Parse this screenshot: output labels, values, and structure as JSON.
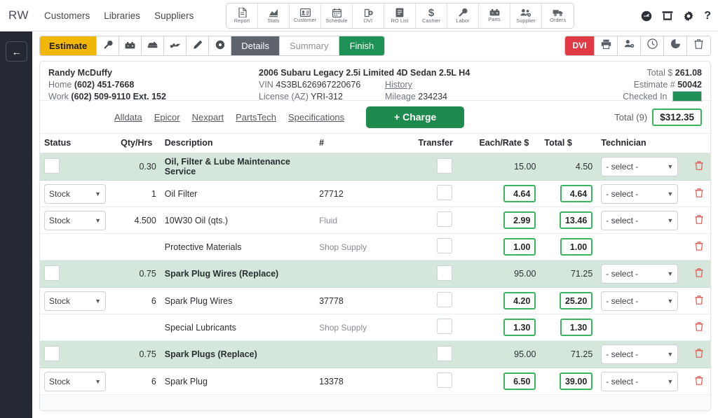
{
  "app": {
    "brand": "RW",
    "nav": [
      {
        "label": "Customers"
      },
      {
        "label": "Libraries"
      },
      {
        "label": "Suppliers"
      }
    ],
    "toolbar": [
      {
        "label": "Report",
        "icon": "report-icon"
      },
      {
        "label": "Stats",
        "icon": "stats-icon"
      },
      {
        "label": "Customer",
        "icon": "customer-card-icon"
      },
      {
        "label": "Schedule",
        "icon": "calendar-icon"
      },
      {
        "label": "DVI",
        "icon": "dvi-icon"
      },
      {
        "label": "RO List",
        "icon": "ro-list-icon"
      },
      {
        "label": "Cashier",
        "icon": "dollar-icon"
      },
      {
        "label": "Labor",
        "icon": "wrench-icon"
      },
      {
        "label": "Parts",
        "icon": "battery-icon"
      },
      {
        "label": "Supplier",
        "icon": "supplier-group-icon"
      },
      {
        "label": "Orders",
        "icon": "truck-icon"
      }
    ],
    "top_right_icons": [
      {
        "name": "dashboard-gauge-icon"
      },
      {
        "name": "shop-store-icon"
      },
      {
        "name": "settings-gear-icon"
      },
      {
        "name": "help-question-icon"
      }
    ]
  },
  "sidebar": {
    "back_label": "←"
  },
  "actionbar": {
    "estimate_label": "Estimate",
    "mode_icons": [
      {
        "name": "wrench-icon"
      },
      {
        "name": "battery-icon"
      },
      {
        "name": "car-repair-icon"
      },
      {
        "name": "oil-can-icon"
      },
      {
        "name": "pen-icon"
      },
      {
        "name": "circle-dot-icon"
      }
    ],
    "details_label": "Details",
    "summary_label": "Summary",
    "finish_label": "Finish",
    "right_buttons": [
      {
        "label": "DVI",
        "name": "dvi-button"
      },
      {
        "label": "",
        "name": "print-icon"
      },
      {
        "label": "",
        "name": "assign-user-icon"
      },
      {
        "label": "",
        "name": "clock-history-icon"
      },
      {
        "label": "",
        "name": "pie-chart-icon"
      },
      {
        "label": "",
        "name": "delete-trash-icon"
      }
    ]
  },
  "customer": {
    "name": "Randy McDuffy",
    "home_label": "Home",
    "home_phone": "(602) 451-7668",
    "work_label": "Work",
    "work_phone": "(602) 509-9110 Ext. 152"
  },
  "vehicle": {
    "title": "2006 Subaru Legacy 2.5i Limited 4D Sedan 2.5L H4",
    "vin_label": "VIN",
    "vin": "4S3BL626967220676",
    "history_link": "History",
    "license_label": "License (AZ)",
    "license": "YRI-312",
    "mileage_label": "Mileage",
    "mileage": "234234"
  },
  "summary": {
    "total_label": "Total $",
    "total_value": "261.08",
    "estimate_label": "Estimate #",
    "estimate_value": "50042",
    "status_label": "Checked In",
    "status_color": "#1e8f57"
  },
  "parts_links": [
    {
      "label": "Alldata"
    },
    {
      "label": "Epicor"
    },
    {
      "label": "Nexpart"
    },
    {
      "label": "PartsTech"
    },
    {
      "label": "Specifications"
    }
  ],
  "charge_button": {
    "label": "+ Charge"
  },
  "line_total": {
    "label": "Total (9)",
    "value": "$312.35"
  },
  "table": {
    "headers": [
      "Status",
      "Qty/Hrs",
      "Description",
      "#",
      "Transfer",
      "Each/Rate $",
      "Total $",
      "Technician"
    ],
    "select_placeholder": "- select -",
    "stock_label": "Stock",
    "rows": [
      {
        "kind": "service",
        "qty": "0.30",
        "description": "Oil, Filter & Lube Maintenance Service",
        "number": "",
        "rate": "15.00",
        "total": "4.50",
        "technician": "- select -"
      },
      {
        "kind": "part",
        "status": "Stock",
        "qty": "1",
        "description": "Oil Filter",
        "number": "27712",
        "rate": "4.64",
        "total": "4.64",
        "technician": "- select -"
      },
      {
        "kind": "part",
        "status": "Stock",
        "qty": "4.500",
        "description": "10W30 Oil (qts.)",
        "number": "Fluid",
        "number_soft": true,
        "rate": "2.99",
        "total": "13.46",
        "technician": "- select -"
      },
      {
        "kind": "supply",
        "status": "",
        "qty": "",
        "description": "Protective Materials",
        "number": "Shop Supply",
        "number_soft": true,
        "rate": "1.00",
        "total": "1.00",
        "technician": ""
      },
      {
        "kind": "service",
        "qty": "0.75",
        "description": "Spark Plug Wires (Replace)",
        "number": "",
        "rate": "95.00",
        "total": "71.25",
        "technician": "- select -"
      },
      {
        "kind": "part",
        "status": "Stock",
        "qty": "6",
        "description": "Spark Plug Wires",
        "number": "37778",
        "rate": "4.20",
        "total": "25.20",
        "technician": "- select -"
      },
      {
        "kind": "supply",
        "status": "",
        "qty": "",
        "description": "Special Lubricants",
        "number": "Shop Supply",
        "number_soft": true,
        "rate": "1.30",
        "total": "1.30",
        "technician": ""
      },
      {
        "kind": "service",
        "qty": "0.75",
        "description": "Spark Plugs (Replace)",
        "number": "",
        "rate": "95.00",
        "total": "71.25",
        "technician": "- select -"
      },
      {
        "kind": "part",
        "status": "Stock",
        "qty": "6",
        "description": "Spark Plug",
        "number": "13378",
        "rate": "6.50",
        "total": "39.00",
        "technician": "- select -"
      }
    ]
  },
  "colors": {
    "estimate_yellow": "#f2b705",
    "finish_green": "#1e9155",
    "dvi_red": "#e03a45",
    "service_row": "#d5e6db",
    "input_border_green": "#3ab45f",
    "sidebar_dark": "#242933"
  }
}
